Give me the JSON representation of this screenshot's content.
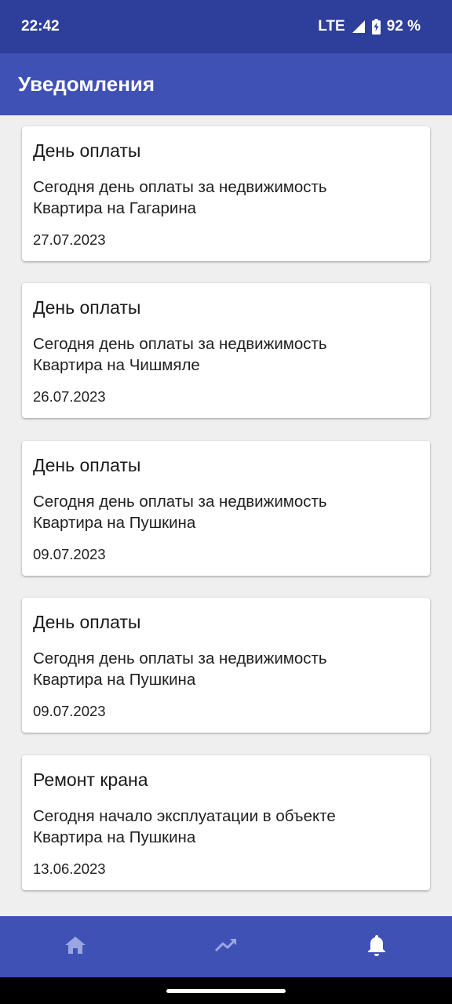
{
  "status_bar": {
    "time": "22:42",
    "network": "LTE",
    "battery": "92 %",
    "icons": [
      "signal-icon",
      "battery-charging-icon"
    ]
  },
  "app_bar": {
    "title": "Уведомления"
  },
  "notifications": [
    {
      "title": "День оплаты",
      "line1": "Сегодня день оплаты за недвижимость",
      "line2": "Квартира на Гагарина",
      "date": "27.07.2023"
    },
    {
      "title": "День оплаты",
      "line1": "Сегодня день оплаты за недвижимость",
      "line2": "Квартира на Чишмяле",
      "date": "26.07.2023"
    },
    {
      "title": "День оплаты",
      "line1": "Сегодня день оплаты за недвижимость",
      "line2": "Квартира на Пушкина",
      "date": "09.07.2023"
    },
    {
      "title": "День оплаты",
      "line1": "Сегодня день оплаты за недвижимость",
      "line2": "Квартира на Пушкина",
      "date": "09.07.2023"
    },
    {
      "title": "Ремонт крана",
      "line1": "Сегодня начало эксплуатации в объекте",
      "line2": "Квартира на Пушкина",
      "date": "13.06.2023"
    }
  ],
  "bottom_nav": {
    "items": [
      {
        "icon": "home-icon",
        "active": false
      },
      {
        "icon": "trending-up-icon",
        "active": false
      },
      {
        "icon": "bell-icon",
        "active": true
      }
    ]
  },
  "colors": {
    "status_bar": "#2e3f9b",
    "primary": "#3f51b5",
    "background": "#efefef",
    "nav_inactive": "#9aa6e0",
    "nav_active": "#ffffff"
  }
}
